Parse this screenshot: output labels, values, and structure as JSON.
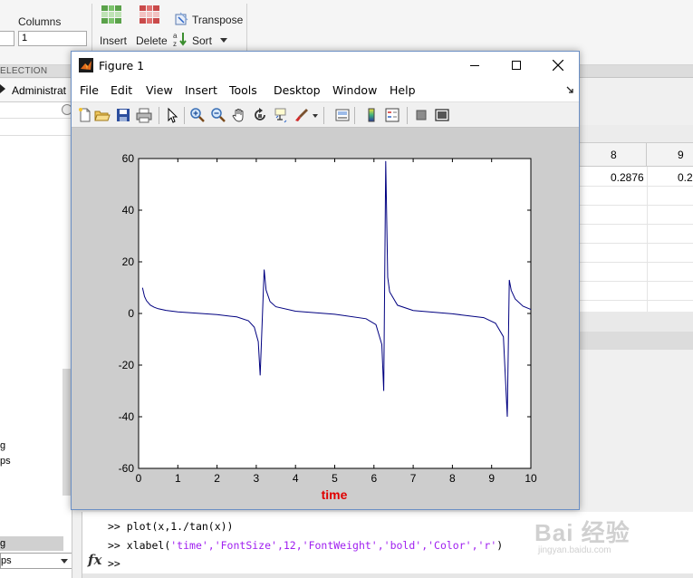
{
  "toolstrip": {
    "columns_label": "Columns",
    "columns_value": "1",
    "insert_label": "Insert",
    "delete_label": "Delete",
    "transpose_label": "Transpose",
    "sort_label": "Sort",
    "section_label": "ELECTION"
  },
  "workspace": {
    "path_text": "Administrat",
    "truncated_items": [
      "g",
      "ps",
      "g",
      "ps"
    ]
  },
  "variable_editor": {
    "col_headers": [
      "8",
      "9"
    ],
    "row1_values": [
      "0.2876",
      "0.2"
    ]
  },
  "command_window": {
    "lines": [
      {
        "prompt": ">> ",
        "code": "plot(x,1./tan(x))"
      },
      {
        "prompt": ">> ",
        "code_pre": "xlabel(",
        "args": "'time','FontSize',12,'FontWeight','bold','Color','r'",
        "code_post": ")"
      },
      {
        "prompt": ">>",
        "code": ""
      }
    ],
    "fx_label": "fx"
  },
  "watermark": {
    "brand": "Bai 经验",
    "url": "jingyan.baidu.com"
  },
  "figure": {
    "title": "Figure 1",
    "menu": [
      "File",
      "Edit",
      "View",
      "Insert",
      "Tools",
      "Desktop",
      "Window",
      "Help"
    ],
    "toolbar_icons": [
      "new-figure-icon",
      "open-file-icon",
      "save-icon",
      "print-icon",
      "edit-plot-arrow-icon",
      "zoom-in-icon",
      "zoom-out-icon",
      "pan-hand-icon",
      "rotate-3d-icon",
      "data-cursor-icon",
      "brush-icon",
      "link-plot-icon",
      "colorbar-icon",
      "legend-icon",
      "hide-plot-tools-icon",
      "show-plot-tools-icon"
    ]
  },
  "chart_data": {
    "type": "line",
    "function": "1./tan(x)",
    "title": "",
    "xlabel": "time",
    "xlabel_color": "#e00000",
    "ylabel": "",
    "xlim": [
      0,
      10
    ],
    "ylim": [
      -60,
      60
    ],
    "xticks": [
      0,
      1,
      2,
      3,
      4,
      5,
      6,
      7,
      8,
      9,
      10
    ],
    "yticks": [
      -60,
      -40,
      -20,
      0,
      20,
      40,
      60
    ],
    "line_color": "#000080",
    "grid": false,
    "series": [
      {
        "x": [
          0.1,
          0.15,
          0.2,
          0.3,
          0.4,
          0.5,
          0.7,
          1.0,
          1.5,
          2.0,
          2.5,
          2.8,
          2.95,
          3.05,
          3.1,
          3.2,
          3.25,
          3.35,
          3.5,
          4.0,
          5.0,
          5.8,
          6.05,
          6.2,
          6.25,
          6.3,
          6.35,
          6.4,
          6.6,
          7.0,
          8.0,
          8.8,
          9.1,
          9.3,
          9.4,
          9.45,
          9.5,
          9.6,
          9.8,
          10.0
        ],
        "y": [
          9.97,
          6.6,
          4.93,
          3.23,
          2.37,
          1.83,
          1.19,
          0.64,
          0.07,
          -0.46,
          -1.34,
          -2.81,
          -5.3,
          -10.9,
          -24,
          17,
          9.1,
          4.6,
          2.6,
          0.86,
          -0.3,
          -2.05,
          -4.3,
          -12,
          -30,
          59,
          14,
          8.4,
          3.2,
          1.15,
          -0.15,
          -1.6,
          -3.8,
          -9.0,
          -40,
          13,
          9.0,
          5.6,
          2.8,
          1.54
        ]
      }
    ]
  }
}
